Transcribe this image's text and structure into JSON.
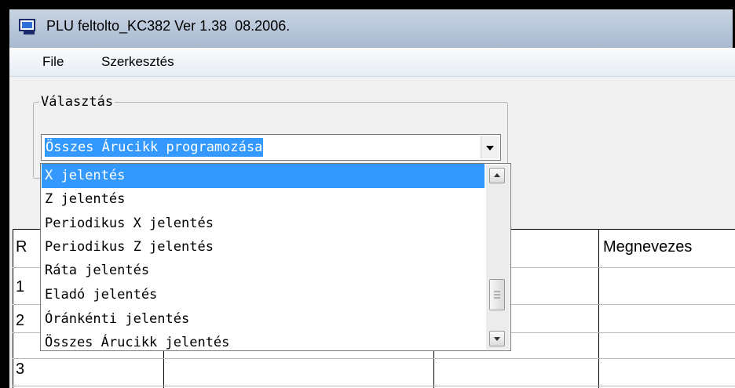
{
  "window": {
    "title": "PLU feltolto_KC382 Ver 1.38  08.2006."
  },
  "menubar": {
    "items": [
      "File",
      "Szerkesztés"
    ]
  },
  "selection_group": {
    "label": "Választás",
    "combo_value": "Összes Árucikk programozása",
    "options": [
      "X jelentés",
      "Z jelentés",
      "Periodikus X jelentés",
      "Periodikus Z jelentés",
      "Ráta jelentés",
      "Eladó jelentés",
      "Óránkénti jelentés",
      "Összes Árucikk jelentés"
    ],
    "selected_option": "X jelentés"
  },
  "grid": {
    "headers": [
      "R",
      "",
      "",
      "Megnevezes"
    ],
    "row_numbers": [
      "1",
      "2",
      "3"
    ]
  },
  "colors": {
    "selection_highlight": "#3399ff",
    "window_background": "#f0f0f0"
  },
  "icons": [
    "app-icon",
    "dropdown-arrow-icon",
    "scroll-up-icon",
    "scroll-down-icon",
    "scroll-grip-icon"
  ]
}
